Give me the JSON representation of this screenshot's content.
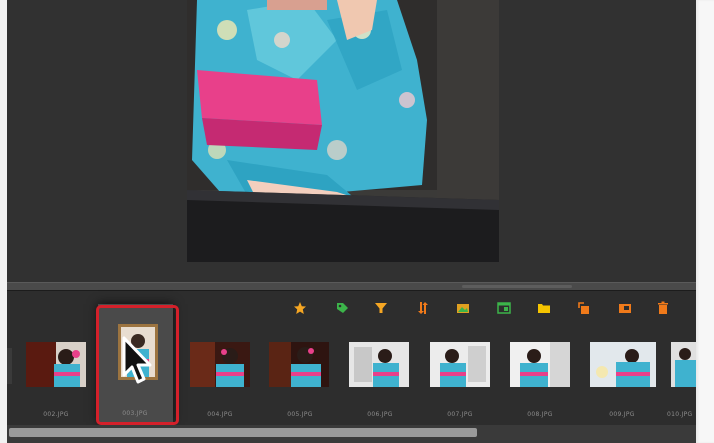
{
  "toolbar": {
    "buttons": [
      {
        "name": "star-rating-button",
        "icon": "star-icon",
        "color": "#f5a623"
      },
      {
        "name": "tag-button",
        "icon": "tag-icon",
        "color": "#3cb44a"
      },
      {
        "name": "filter-button",
        "icon": "filter-icon",
        "color": "#f5a623"
      },
      {
        "name": "sort-button",
        "icon": "sort-arrows-icon",
        "color": "#f07a1a"
      },
      {
        "name": "slideshow-button",
        "icon": "image-icon",
        "color": "#e0a020"
      },
      {
        "name": "view-button",
        "icon": "window-icon",
        "color": "#3cb44a"
      },
      {
        "name": "folder-button",
        "icon": "folder-icon",
        "color": "#f5c400"
      },
      {
        "name": "rotate-left-button",
        "icon": "rotate-left-icon",
        "color": "#f07a1a"
      },
      {
        "name": "rotate-right-button",
        "icon": "rotate-right-icon",
        "color": "#f07a1a"
      },
      {
        "name": "delete-button",
        "icon": "trash-icon",
        "color": "#f07a1a"
      }
    ]
  },
  "filmstrip": {
    "items": [
      {
        "filename": "002.JPG",
        "selected": false
      },
      {
        "filename": "003.JPG",
        "selected": true
      },
      {
        "filename": "004.JPG",
        "selected": false
      },
      {
        "filename": "005.JPG",
        "selected": false
      },
      {
        "filename": "006.JPG",
        "selected": false
      },
      {
        "filename": "007.JPG",
        "selected": false
      },
      {
        "filename": "008.JPG",
        "selected": false
      },
      {
        "filename": "009.JPG",
        "selected": false
      },
      {
        "filename": "010.JPG",
        "selected": false
      }
    ]
  },
  "colors": {
    "viewer_bg": "#313131",
    "filmstrip_bg": "#2d2d2d",
    "selection_highlight": "#d4202a"
  }
}
